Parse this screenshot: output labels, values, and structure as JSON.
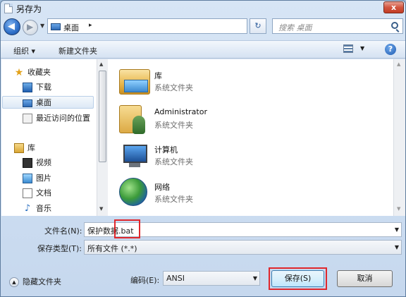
{
  "window": {
    "title": "另存为",
    "close_label": "x"
  },
  "nav": {
    "back_glyph": "◀",
    "forward_glyph": "▶",
    "address_text": "桌面",
    "address_chevron": "▸",
    "refresh_glyph": "↻",
    "search_placeholder": "搜索 桌面"
  },
  "toolbar": {
    "organize": "组织 ▾",
    "new_folder": "新建文件夹",
    "help": "?"
  },
  "sidebar": {
    "favorites": "收藏夹",
    "downloads": "下载",
    "desktop": "桌面",
    "recent": "最近访问的位置",
    "libraries": "库",
    "videos": "视频",
    "pictures": "图片",
    "documents": "文档",
    "music": "音乐"
  },
  "files": [
    {
      "name": "库",
      "type": "系统文件夹",
      "icon": "library-icon"
    },
    {
      "name": "Administrator",
      "type": "系统文件夹",
      "icon": "user-folder-icon"
    },
    {
      "name": "计算机",
      "type": "系统文件夹",
      "icon": "computer-icon"
    },
    {
      "name": "网络",
      "type": "系统文件夹",
      "icon": "network-icon"
    }
  ],
  "form": {
    "filename_label": "文件名(N):",
    "filename_value": "保护数据.bat",
    "filetype_label": "保存类型(T):",
    "filetype_value": "所有文件  (*.*)",
    "encoding_label": "编码(E):",
    "encoding_value": "ANSI"
  },
  "footer": {
    "hide_folders": "隐藏文件夹",
    "save": "保存(S)",
    "cancel": "取消"
  },
  "colors": {
    "highlight": "#e0272c",
    "accent": "#3c7fb1"
  }
}
